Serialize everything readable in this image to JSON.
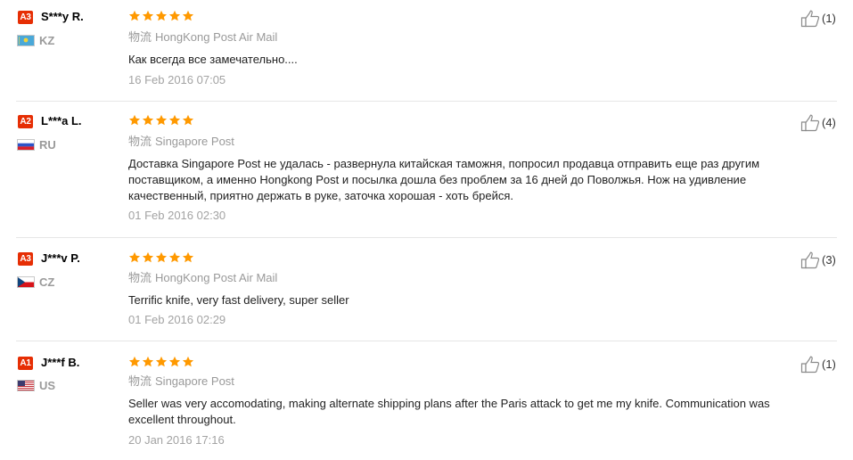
{
  "logistics_prefix": "物流",
  "reviews": [
    {
      "level": "A3",
      "username": "S***y R.",
      "country": "KZ",
      "rating_stars": 5,
      "logistics": "HongKong Post Air Mail",
      "content": "Как всегда все замечательно....",
      "date": "16 Feb 2016 07:05",
      "helpful": "(1)"
    },
    {
      "level": "A2",
      "username": "L***a L.",
      "country": "RU",
      "rating_stars": 5,
      "logistics": "Singapore Post",
      "content": "Доставка Singapore Post не удалась - развернула китайская таможня, попросил продавца отправить еще раз другим поставщиком, а именно Hongkong Post и посылка дошла без проблем за 16 дней до Поволжья. Нож на удивление качественный, приятно держать в руке, заточка хорошая - хоть брейся.",
      "date": "01 Feb 2016 02:30",
      "helpful": "(4)"
    },
    {
      "level": "A3",
      "username": "J***v P.",
      "country": "CZ",
      "rating_stars": 5,
      "logistics": "HongKong Post Air Mail",
      "content": "Terrific knife, very fast delivery, super seller",
      "date": "01 Feb 2016 02:29",
      "helpful": "(3)"
    },
    {
      "level": "A1",
      "username": "J***f B.",
      "country": "US",
      "rating_stars": 5,
      "logistics": "Singapore Post",
      "content": "Seller was very accomodating, making alternate shipping plans after the Paris attack to get me my knife. Communication was excellent throughout.",
      "date": "20 Jan 2016 17:16",
      "helpful": "(1)"
    }
  ],
  "colors": {
    "badge": "#e62e04",
    "star": "#ff9900",
    "muted": "#999999"
  }
}
